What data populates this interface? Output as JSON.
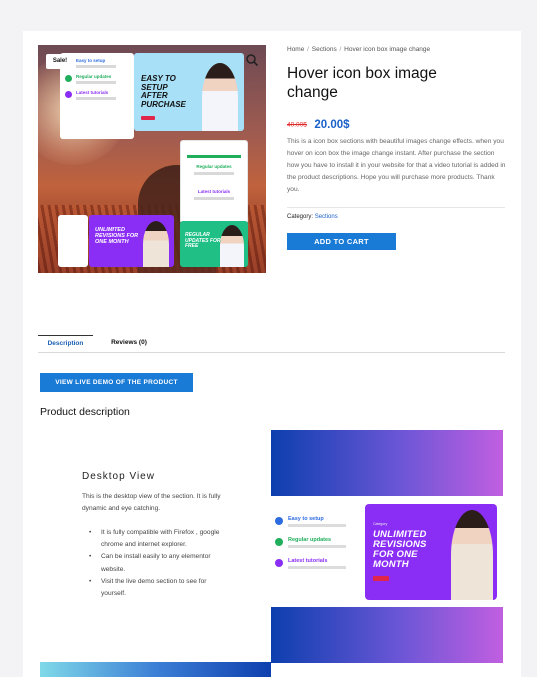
{
  "gallery": {
    "sale_badge": "Sale!",
    "mock": {
      "items": [
        {
          "title": "Easy to setup",
          "color": "#2d6be0"
        },
        {
          "title": "Regular updates",
          "color": "#1fae5b"
        },
        {
          "title": "Latest tutorials",
          "color": "#8b2ef5"
        }
      ],
      "promo_blue": "EASY TO SETUP AFTER PURCHASE",
      "promo_purple": "UNLIMITED REVISIONS FOR ONE MONTH",
      "promo_teal": "REGULAR UPDATES FOR FREE",
      "green_box_items": [
        "Regular updates",
        "Latest tutorials"
      ]
    }
  },
  "breadcrumb": {
    "home": "Home",
    "sections": "Sections",
    "current": "Hover icon box image change"
  },
  "product": {
    "title": "Hover icon box image change",
    "old_price": "40.00$",
    "price": "20.00$",
    "description": "This is a icon box sections with beautiful images change effects. when you hover on icon box the image change instant. After purchase the section how you have to install it in your website for that a video tutorial is added in the product descriptions. Hope you will purchase more products. Thank you.",
    "category_label": "Category:",
    "category": "Sections",
    "add_to_cart": "ADD TO CART"
  },
  "tabs": [
    {
      "label": "Description",
      "active": true
    },
    {
      "label": "Reviews (0)",
      "active": false
    }
  ],
  "content": {
    "live_demo_button": "VIEW LIVE DEMO OF THE PRODUCT",
    "heading": "Product description",
    "desktop": {
      "title": "Desktop View",
      "text": "This is the desktop view of the section. It is fully dynamic and eye catching.",
      "bullets": [
        "It is fully compatible with Firefox , google chrome and internet explorer.",
        "Can be install easily to any elementor website.",
        "Visit the live demo section to see for yourself."
      ]
    },
    "screenshot": {
      "items": [
        {
          "title": "Easy to setup",
          "color": "#2d6be0"
        },
        {
          "title": "Regular updates",
          "color": "#1fae5b"
        },
        {
          "title": "Latest tutorials",
          "color": "#8b2ef5"
        }
      ],
      "promo_small": "Category",
      "promo": "UNLIMITED REVISIONS FOR ONE MONTH"
    }
  },
  "colors": {
    "accent": "#1a7bd6",
    "price": "#1a61c9",
    "old_price": "#e02a2a",
    "purple": "#8b2ef5"
  }
}
